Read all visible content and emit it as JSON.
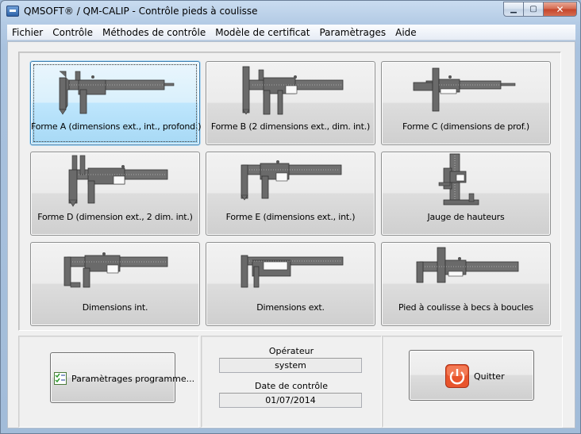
{
  "window": {
    "title": "QMSOFT® / QM-CALIP - Contrôle pieds à coulisse",
    "minimize_glyph": "▁",
    "maximize_glyph": "▢",
    "close_glyph": "✕"
  },
  "menu": [
    {
      "label": "Fichier"
    },
    {
      "label": "Contrôle"
    },
    {
      "label": "Méthodes de contrôle"
    },
    {
      "label": "Modèle de certificat"
    },
    {
      "label": "Paramètrages"
    },
    {
      "label": "Aide"
    }
  ],
  "tiles": [
    {
      "label": "Forme A (dimensions ext., int., profond.)",
      "icon": "caliper-form-a-icon",
      "selected": true
    },
    {
      "label": "Forme B (2 dimensions ext., dim. int.)",
      "icon": "caliper-form-b-icon",
      "selected": false
    },
    {
      "label": "Forme C (dimensions de prof.)",
      "icon": "caliper-form-c-icon",
      "selected": false
    },
    {
      "label": "Forme D (dimension ext., 2 dim. int.)",
      "icon": "caliper-form-d-icon",
      "selected": false
    },
    {
      "label": "Forme E (dimensions ext., int.)",
      "icon": "caliper-form-e-icon",
      "selected": false
    },
    {
      "label": "Jauge de hauteurs",
      "icon": "height-gauge-icon",
      "selected": false
    },
    {
      "label": "Dimensions int.",
      "icon": "caliper-internal-icon",
      "selected": false
    },
    {
      "label": "Dimensions ext.",
      "icon": "caliper-external-icon",
      "selected": false
    },
    {
      "label": "Pied à coulisse à becs à boucles",
      "icon": "caliper-loop-jaws-icon",
      "selected": false
    }
  ],
  "settings_button": {
    "label": "Paramètrages programme...",
    "icon": "checklist-icon"
  },
  "operator": {
    "label": "Opérateur",
    "value": "system"
  },
  "control_date": {
    "label": "Date de contrôle",
    "value": "01/07/2014"
  },
  "quit_button": {
    "label": "Quitter",
    "icon": "power-icon"
  },
  "colors": {
    "selected_tile": "#bee6fd",
    "quit_icon": "#e8542c",
    "caliper": "#6e6e6e"
  }
}
